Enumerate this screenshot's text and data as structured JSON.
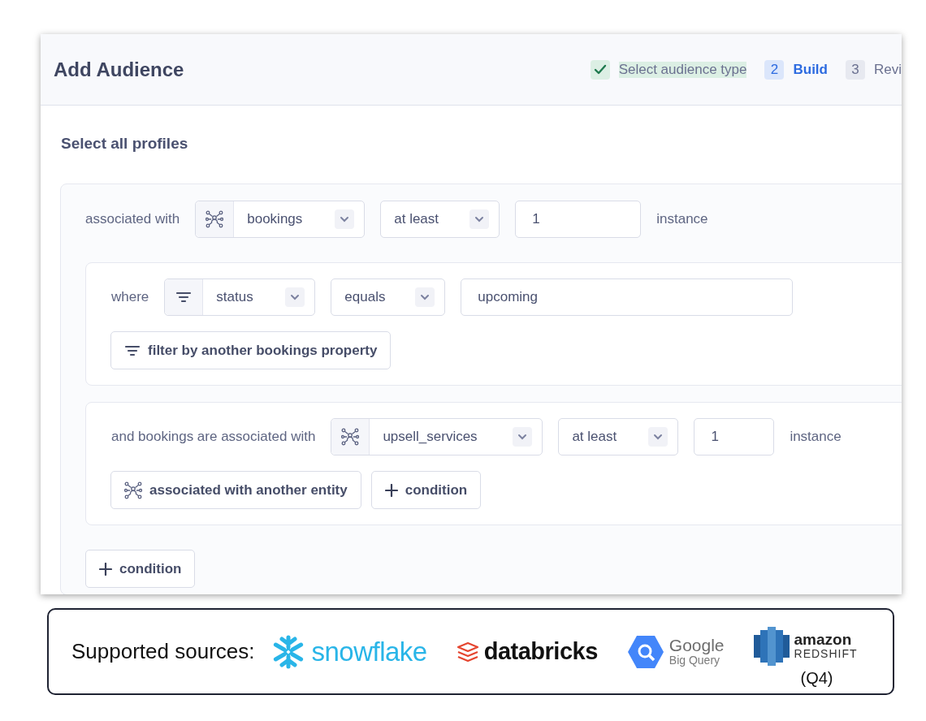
{
  "header": {
    "title": "Add Audience",
    "steps": [
      {
        "kind": "done",
        "label": "Select audience type"
      },
      {
        "kind": "current",
        "number": "2",
        "label": "Build"
      },
      {
        "kind": "upcoming",
        "number": "3",
        "label": "Revi"
      }
    ]
  },
  "heading": "Select all profiles",
  "group": {
    "label": "associated with",
    "entity": "bookings",
    "quantifier": "at least",
    "count": "1",
    "unit": "instance",
    "filter_block": {
      "label": "where",
      "property": "status",
      "operator": "equals",
      "value": "upcoming",
      "add_button": "filter by another bookings property"
    },
    "association_block": {
      "label": "and bookings are associated with",
      "entity": "upsell_services",
      "quantifier": "at least",
      "count": "1",
      "unit": "instance",
      "buttons": [
        {
          "kind": "entity",
          "label": "associated with another entity"
        },
        {
          "kind": "add",
          "label": "condition"
        }
      ]
    },
    "add_button": "condition"
  },
  "sources": {
    "label": "Supported sources:",
    "items": [
      {
        "kind": "snowflake",
        "name": "snowflake"
      },
      {
        "kind": "databricks",
        "name": "databricks"
      },
      {
        "kind": "bigquery",
        "name": "Google",
        "sub": "Big Query"
      },
      {
        "kind": "redshift",
        "name": "amazon",
        "sub": "REDSHIFT",
        "note": "(Q4)"
      }
    ]
  }
}
